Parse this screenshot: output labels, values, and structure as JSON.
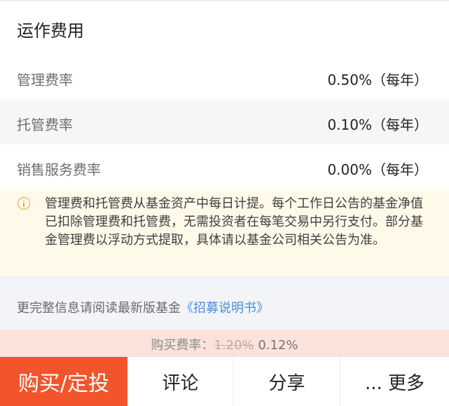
{
  "section": {
    "title": "运作费用"
  },
  "fees": [
    {
      "label": "管理费率",
      "value": "0.50%（每年）"
    },
    {
      "label": "托管费率",
      "value": "0.10%（每年）"
    },
    {
      "label": "销售服务费率",
      "value": "0.00%（每年）"
    }
  ],
  "notice": {
    "icon": "info-icon",
    "text": "管理费和托管费从基金资产中每日计提。每个工作日公告的基金净值已扣除管理费和托管费，无需投资者在每笔交易中另行支付。部分基金管理费以浮动方式提取，具体请以基金公司相关公告为准。"
  },
  "prospectus": {
    "text": "更完整信息请阅读最新版基金",
    "link": "《招募说明书》"
  },
  "purchase_fee": {
    "label": "购买费率：",
    "original": "1.20%",
    "discounted": "0.12%"
  },
  "actions": {
    "buy": "购买/定投",
    "comment": "评论",
    "share": "分享",
    "more": "... 更多"
  },
  "colors": {
    "accent": "#f2542c",
    "link": "#4a8ee0",
    "notice_bg": "#fef9e9",
    "notice_icon": "#e7a845",
    "fee_bar_bg": "#fbe3dc"
  }
}
